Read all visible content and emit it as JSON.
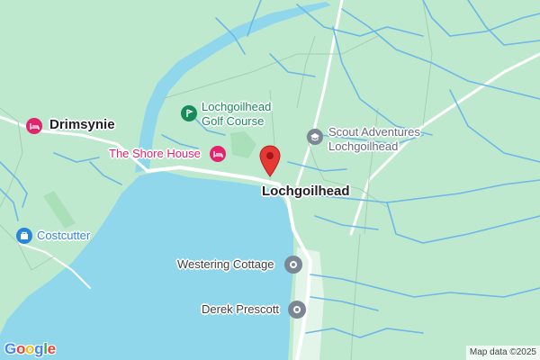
{
  "colors": {
    "land": "#bfe9cf",
    "water": "#90d7ec",
    "stream": "#6cb8e6",
    "road": "#ffffff",
    "poi_hotel": "#e2246e",
    "poi_recreation": "#168a5a",
    "poi_generic": "#7b8794",
    "poi_shop": "#2a87d8",
    "marker": "#e53935",
    "town_text": "#202124"
  },
  "places": {
    "golf": {
      "line1": "Lochgoilhead",
      "line2": "Golf Course",
      "icon": "golf-icon"
    },
    "drimsynie": {
      "label": "Drimsynie",
      "icon": "hotel-icon"
    },
    "shore_house": {
      "label": "The Shore House",
      "icon": "hotel-icon"
    },
    "scout": {
      "line1": "Scout Adventures",
      "line2": "Lochgoilhead",
      "icon": "school-icon"
    },
    "town": {
      "label": "Lochgoilhead",
      "icon": "marker-pin-icon"
    },
    "costcutter": {
      "label": "Costcutter",
      "icon": "shopping-bag-icon"
    },
    "westering": {
      "label": "Westering Cottage",
      "icon": "generic-poi-icon"
    },
    "derek": {
      "label": "Derek Prescott",
      "icon": "generic-poi-icon"
    }
  },
  "footer": {
    "google_logo": [
      "G",
      "o",
      "o",
      "g",
      "l",
      "e"
    ],
    "google_colors": [
      "#4285F4",
      "#EA4335",
      "#FBBC05",
      "#4285F4",
      "#34A853",
      "#EA4335"
    ],
    "attribution": "Map data ©2025"
  }
}
